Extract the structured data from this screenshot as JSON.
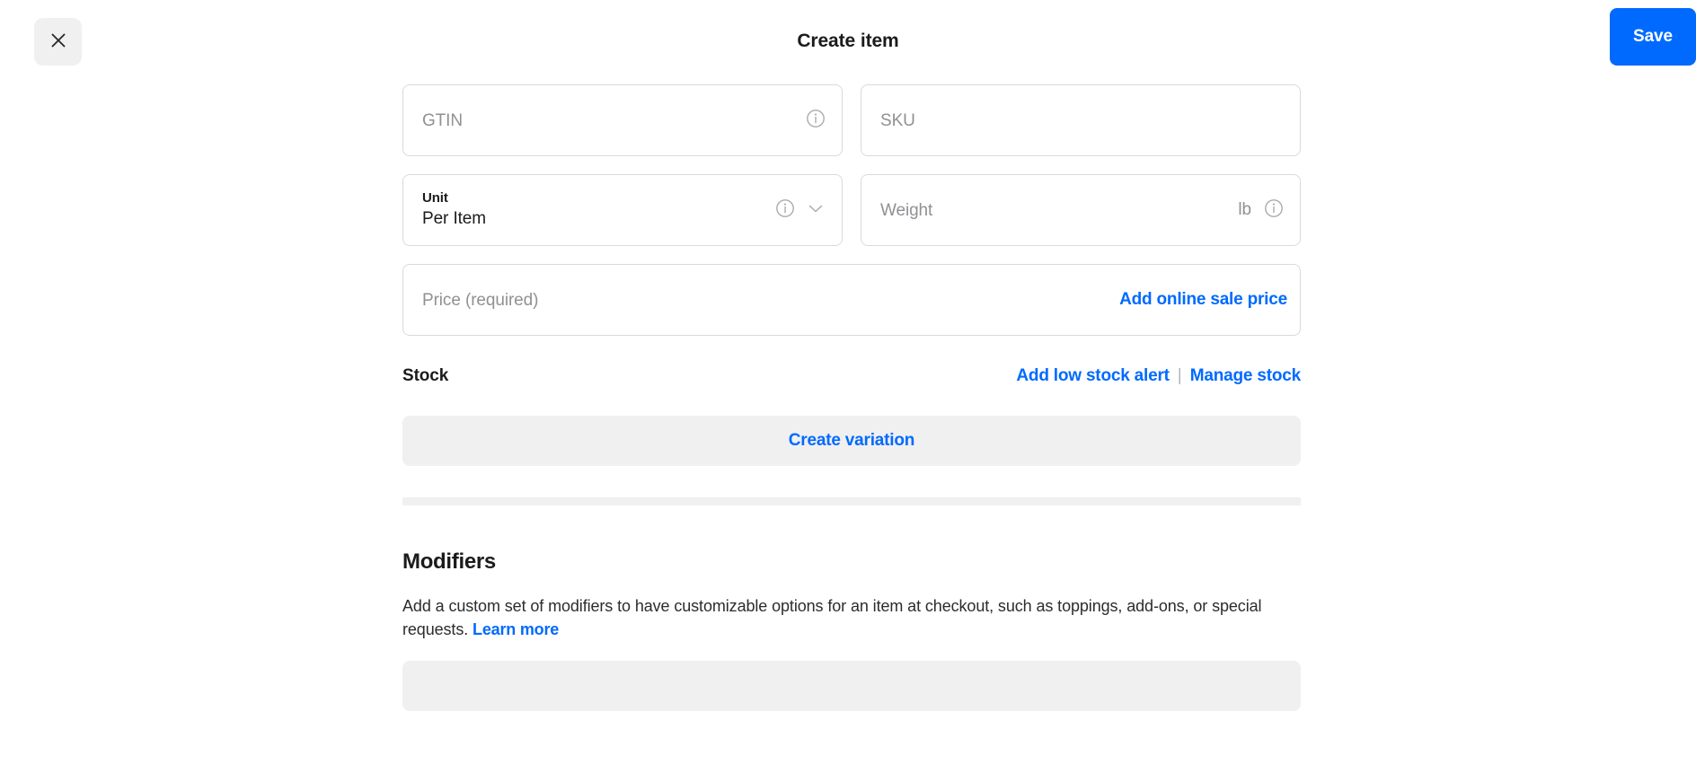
{
  "header": {
    "close_icon": "close-icon",
    "title": "Create item",
    "save_label": "Save"
  },
  "form": {
    "gtin": {
      "placeholder": "GTIN",
      "info_icon": "info-icon"
    },
    "sku": {
      "placeholder": "SKU"
    },
    "unit": {
      "label": "Unit",
      "value": "Per Item",
      "info_icon": "info-icon",
      "chevron_icon": "chevron-down-icon"
    },
    "weight": {
      "placeholder": "Weight",
      "suffix": "lb",
      "info_icon": "info-icon"
    },
    "price": {
      "placeholder": "Price (required)",
      "link_label": "Add online sale price"
    }
  },
  "stock": {
    "label": "Stock",
    "add_alert_label": "Add low stock alert",
    "separator": "|",
    "manage_label": "Manage stock"
  },
  "variation": {
    "button_label": "Create variation"
  },
  "modifiers": {
    "title": "Modifiers",
    "description": "Add a custom set of modifiers to have customizable options for an item at checkout, such as toppings, add-ons, or special requests.",
    "learn_more_label": "Learn more"
  },
  "colors": {
    "accent_blue": "#006aff",
    "gray_surface": "#f0f0f0",
    "border": "#d8dadc",
    "placeholder": "#8f9194"
  }
}
